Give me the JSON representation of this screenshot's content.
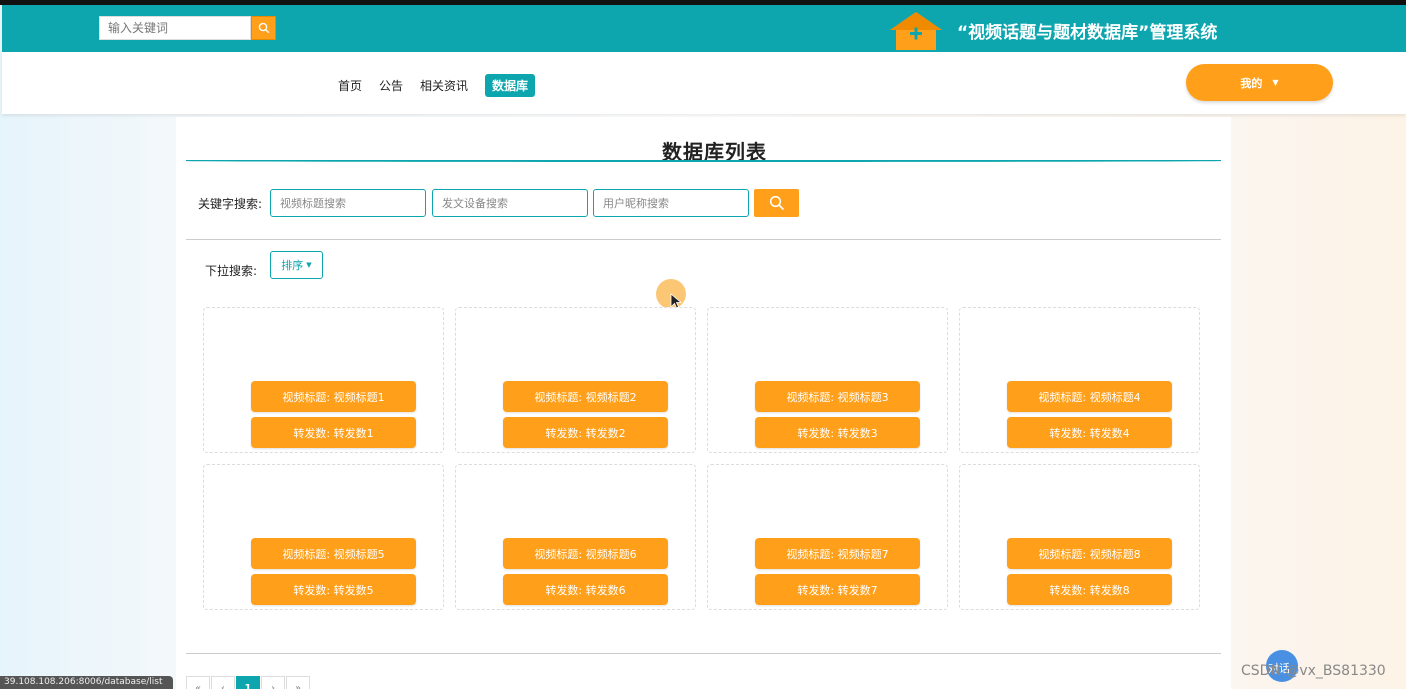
{
  "top_bar": {
    "search_placeholder": "输入关键词",
    "site_title": "“视频话题与题材数据库”管理系统",
    "colors": {
      "teal": "#0ea6ae",
      "orange": "#ff9f1a"
    }
  },
  "nav": {
    "items": [
      {
        "label": "首页",
        "active": false
      },
      {
        "label": "公告",
        "active": false
      },
      {
        "label": "相关资讯",
        "active": false
      },
      {
        "label": "数据库",
        "active": true
      }
    ],
    "user_menu_label": "我的"
  },
  "main": {
    "title": "数据库列表",
    "keyword_search_label": "关键字搜索:",
    "keyword_inputs": [
      {
        "placeholder": "视频标题搜索"
      },
      {
        "placeholder": "发文设备搜索"
      },
      {
        "placeholder": "用户昵称搜索"
      }
    ],
    "dropdown_label": "下拉搜索:",
    "sort_label": "排序",
    "cards": [
      {
        "title_chip": "视频标题: 视频标题1",
        "repost_chip": "转发数: 转发数1"
      },
      {
        "title_chip": "视频标题: 视频标题2",
        "repost_chip": "转发数: 转发数2"
      },
      {
        "title_chip": "视频标题: 视频标题3",
        "repost_chip": "转发数: 转发数3"
      },
      {
        "title_chip": "视频标题: 视频标题4",
        "repost_chip": "转发数: 转发数4"
      },
      {
        "title_chip": "视频标题: 视频标题5",
        "repost_chip": "转发数: 转发数5"
      },
      {
        "title_chip": "视频标题: 视频标题6",
        "repost_chip": "转发数: 转发数6"
      },
      {
        "title_chip": "视频标题: 视频标题7",
        "repost_chip": "转发数: 转发数7"
      },
      {
        "title_chip": "视频标题: 视频标题8",
        "repost_chip": "转发数: 转发数8"
      }
    ],
    "pagination": [
      "«",
      "‹",
      "1",
      "›",
      "»"
    ]
  },
  "status": {
    "url": "39.108.108.206:8006/database/list",
    "float_button_label": "对话",
    "watermark": "CSDN @vx_BS81330"
  }
}
